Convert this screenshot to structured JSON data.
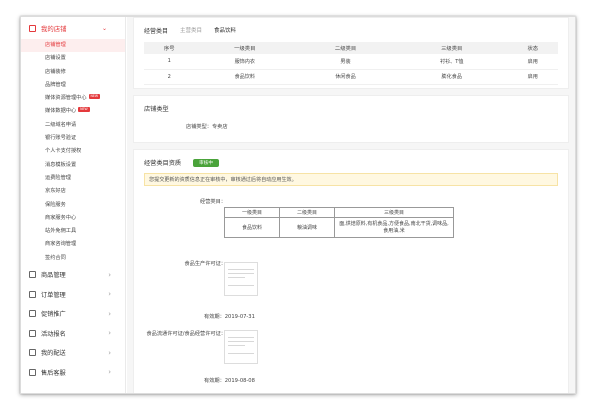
{
  "sidebar": {
    "store_head": "我的店铺",
    "items": [
      {
        "label": "店铺管理",
        "active": true
      },
      {
        "label": "店铺设置"
      },
      {
        "label": "店铺装修"
      },
      {
        "label": "品牌管理"
      },
      {
        "label": "媒体资源管理中心",
        "tag": "NEW"
      },
      {
        "label": "媒体数据中心",
        "tag": "NEW"
      },
      {
        "label": "二级域名申请"
      },
      {
        "label": "银行账号验证"
      },
      {
        "label": "个人卡支付授权"
      },
      {
        "label": "消息模板设置"
      },
      {
        "label": "运费险管理"
      },
      {
        "label": "京东好店"
      },
      {
        "label": "保险服务"
      },
      {
        "label": "商家服务中心"
      },
      {
        "label": "站外免佣工具"
      },
      {
        "label": "商家咨询管理"
      },
      {
        "label": "签约合同"
      }
    ],
    "groups": [
      "商品管理",
      "订单管理",
      "促销推广",
      "活动报名",
      "我的配送",
      "售后客服"
    ]
  },
  "category": {
    "title": "经营类目",
    "crumb_main": "主营类目",
    "crumb_value": "食品饮料",
    "headers": [
      "序号",
      "一级类目",
      "二级类目",
      "三级类目",
      "状态"
    ],
    "rows": [
      [
        "1",
        "服饰内衣",
        "男装",
        "衬衫、T恤",
        "启用"
      ],
      [
        "2",
        "食品饮料",
        "休闲食品",
        "膨化食品",
        "启用"
      ]
    ]
  },
  "store_type": {
    "title": "店铺类型",
    "label": "店铺类型：专卖店"
  },
  "qualification": {
    "title": "经营类目资质",
    "badge": "审核中",
    "notice": "您提交更新的资质信息正在审核中，审核通过后将自动应用生效。",
    "category_label": "经营类目：",
    "table_headers": [
      "一级类目",
      "二级类目",
      "三级类目"
    ],
    "table_row": [
      "食品饮料",
      "粮油调味",
      "面,烘焙原料,有机食品,方便食品,南北干货,调味品,食用油,米"
    ],
    "license1_label": "食品生产许可证：",
    "license1_expiry": "有效期：2019-07-31",
    "license2_label": "食品流通许可证/食品经营许可证：",
    "license2_expiry": "有效期：2019-08-08"
  },
  "colors": {
    "accent": "#e4393c",
    "ok": "#3a9d23",
    "badge": "#4aa33a"
  }
}
